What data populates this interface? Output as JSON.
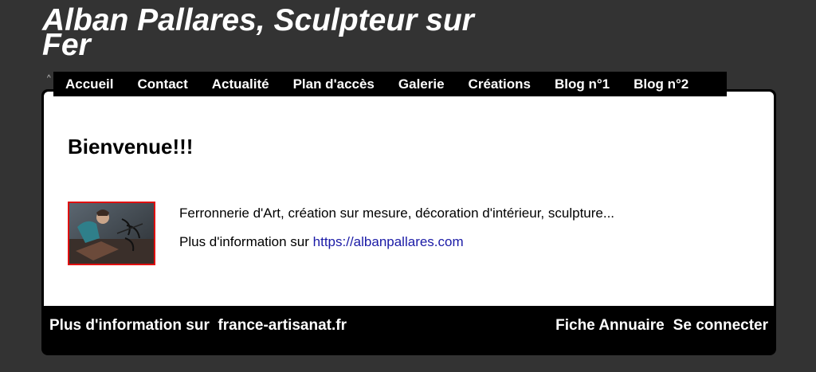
{
  "header": {
    "title": "Alban Pallares, Sculpteur sur Fer"
  },
  "nav": {
    "items": [
      {
        "label": "Accueil"
      },
      {
        "label": "Contact"
      },
      {
        "label": "Actualité"
      },
      {
        "label": "Plan d'accès"
      },
      {
        "label": "Galerie"
      },
      {
        "label": "Créations"
      },
      {
        "label": "Blog n°1"
      },
      {
        "label": "Blog n°2"
      }
    ]
  },
  "main": {
    "heading": "Bienvenue!!!",
    "description": "Ferronnerie d'Art, création sur mesure, décoration d'intérieur, sculpture...",
    "more_info_prefix": "Plus d'information sur ",
    "more_info_link": "https://albanpallares.com"
  },
  "footer": {
    "left_text": "Plus d'information sur  france-artisanat.fr",
    "fiche_label": "Fiche Annuaire",
    "login_label": "Se connecter"
  },
  "colors": {
    "background": "#333333",
    "nav_background": "#000000",
    "link": "#1a1aa6",
    "thumb_border": "#e01010"
  }
}
